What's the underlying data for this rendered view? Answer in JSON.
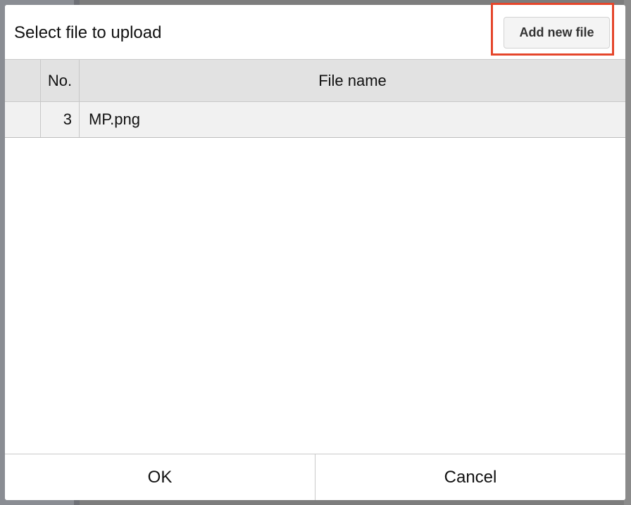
{
  "dialog": {
    "title": "Select file to upload",
    "add_button_label": "Add new file",
    "highlight_color": "#e5462b"
  },
  "table": {
    "columns": [
      "",
      "No.",
      "File name"
    ],
    "rows": [
      {
        "no": "3",
        "file_name": "MP.png"
      }
    ]
  },
  "footer": {
    "ok_label": "OK",
    "cancel_label": "Cancel"
  }
}
